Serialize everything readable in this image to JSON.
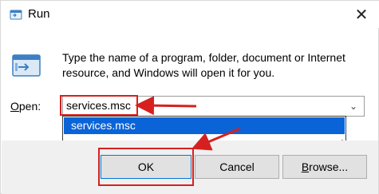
{
  "window": {
    "title": "Run",
    "close_glyph": "✕"
  },
  "description": "Type the name of a program, folder, document or Internet resource, and Windows will open it for you.",
  "open_field": {
    "label_prefix": "",
    "label_accel": "O",
    "label_rest": "pen:",
    "value": "services.msc",
    "dropdown_glyph": "⌄"
  },
  "dropdown": {
    "items": [
      "services.msc"
    ],
    "selected_index": 0
  },
  "buttons": {
    "ok": "OK",
    "cancel": "Cancel",
    "browse_accel": "B",
    "browse_rest": "rowse..."
  },
  "colors": {
    "annotation_red": "#d62020",
    "selection_blue": "#0a64d8",
    "footer_gray": "#f0f0f0"
  },
  "icons": {
    "title": "run-icon",
    "main": "run-program-icon",
    "close": "close-icon"
  }
}
